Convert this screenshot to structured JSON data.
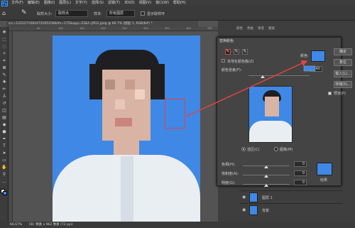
{
  "menubar": {
    "app_logo": "Ps",
    "items": [
      "文件(F)",
      "编辑(E)",
      "图像(I)",
      "图层(L)",
      "文字(Y)",
      "选择(S)",
      "滤镜(T)",
      "3D(D)",
      "视图(V)",
      "窗口(W)",
      "帮助(H)"
    ]
  },
  "optbar": {
    "sample_size_label": "取样大小:",
    "sample_size_value": "取样点",
    "sample_label": "样本:",
    "sample_value": "所有图层",
    "show_ring_label": "显示取样环"
  },
  "document_tab": {
    "title": "src=1221271082472165258&fm=175&app=25&f=JPEG.jpeg @ 66.7% (图层 1, RGB/8#) *"
  },
  "ruler": {
    "ticks": [
      "50",
      "100",
      "150",
      "200",
      "250",
      "300",
      "350",
      "400",
      "450"
    ]
  },
  "right_panel_tabs": [
    "颜色",
    "色板",
    "渐变",
    "图案"
  ],
  "dialog": {
    "title": "替换颜色",
    "localized_label": "本地化颜色簇(Z)",
    "color_label": "颜色:",
    "fuzziness_label": "颜色容差(F):",
    "fuzziness_value": "40",
    "selection_label": "选区(C)",
    "image_label": "图像(M)",
    "replacement": {
      "hue_label": "色相(H):",
      "hue_value": "0",
      "saturation_label": "饱和度(A):",
      "saturation_value": "0",
      "lightness_label": "明度(G):",
      "lightness_value": "0",
      "result_label": "结果"
    },
    "buttons": {
      "ok": "确定",
      "cancel": "复位",
      "load": "载入(L)...",
      "save": "存储(S)..."
    },
    "preview_label": "预览(P)",
    "sample_color": "#3f88e6",
    "result_color": "#3f88e6"
  },
  "layers": [
    {
      "name": "图层 1"
    },
    {
      "name": "背景"
    }
  ],
  "statusbar": {
    "zoom": "66.67%",
    "info": "(ID: 像素 x 962 像素 (72 ppi)"
  },
  "colors": {
    "accent_red": "#e04545",
    "photo_blue": "#3f88e6"
  }
}
